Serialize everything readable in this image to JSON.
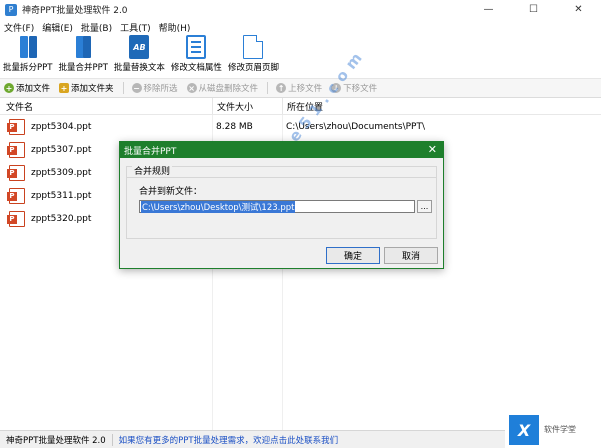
{
  "window": {
    "title": "神奇PPT批量处理软件 2.0",
    "controls": {
      "minimize": "—",
      "maximize": "☐",
      "close": "✕"
    }
  },
  "menu": [
    "文件(F)",
    "编辑(E)",
    "批量(B)",
    "工具(T)",
    "帮助(H)"
  ],
  "toolbar": {
    "split": "批量拆分PPT",
    "merge": "批量合并PPT",
    "replace": "批量替换文本",
    "props": "修改文档属性",
    "header_footer": "修改页眉页脚",
    "replace_icon_text": "AB"
  },
  "toolbar2": {
    "add_file": "添加文件",
    "add_folder": "添加文件夹",
    "remove_selected": "移除所选",
    "delete_from_disk": "从磁盘删除文件",
    "move_up": "上移文件",
    "move_down": "下移文件"
  },
  "list": {
    "columns": {
      "name": "文件名",
      "size": "文件大小",
      "location": "所在位置"
    },
    "rows": [
      {
        "name": "zppt5304.ppt",
        "size": "8.28 MB",
        "location": "C:\\Users\\zhou\\Documents\\PPT\\"
      },
      {
        "name": "zppt5307.ppt",
        "size": "",
        "location": ""
      },
      {
        "name": "zppt5309.ppt",
        "size": "",
        "location": ""
      },
      {
        "name": "zppt5311.ppt",
        "size": "",
        "location": ""
      },
      {
        "name": "zppt5320.ppt",
        "size": "",
        "location": ""
      }
    ]
  },
  "dialog": {
    "title": "批量合并PPT",
    "group_title": "合并规则",
    "field_label": "合并到新文件：",
    "path_value": "C:\\Users\\zhou\\Desktop\\测试\\123.ppt",
    "browse": "...",
    "ok": "确定",
    "cancel": "取消",
    "close": "✕"
  },
  "status": {
    "app_name": "神奇PPT批量处理软件 2.0",
    "link": "如果您有更多的PPT批量处理需求，欢迎点击此处联系我们"
  },
  "watermark": {
    "text": "www.xue51.com",
    "cn": "软件学堂"
  },
  "corner_logo": {
    "mark": "X",
    "text": "软件学堂"
  },
  "colors": {
    "accent_blue": "#2b7fd6",
    "dialog_green": "#1e7f2c",
    "link_blue": "#1a4fc4",
    "ppt_red": "#d24726"
  }
}
